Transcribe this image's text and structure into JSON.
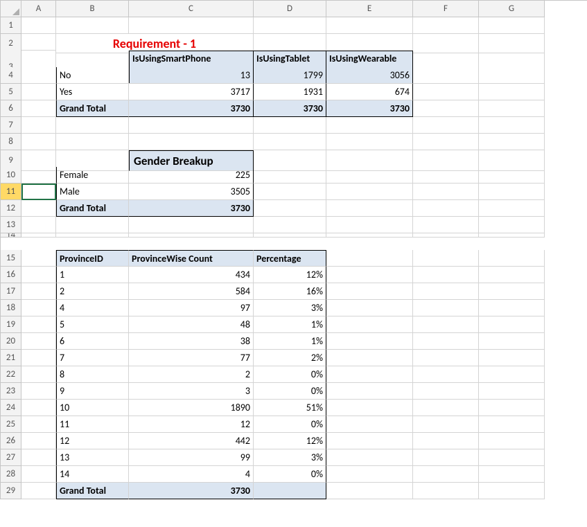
{
  "columns": [
    "",
    "A",
    "B",
    "C",
    "D",
    "E",
    "F",
    "G"
  ],
  "title": "Requirement - 1",
  "table1": {
    "headers": [
      "IsUsingSmartPhone",
      "IsUsingTablet",
      "IsUsingWearable"
    ],
    "rows": [
      {
        "label": "No",
        "c": "13",
        "d": "1799",
        "e": "3056"
      },
      {
        "label": "Yes",
        "c": "3717",
        "d": "1931",
        "e": "674"
      }
    ],
    "total_label": "Grand Total",
    "total": {
      "c": "3730",
      "d": "3730",
      "e": "3730"
    }
  },
  "gender": {
    "title": "Gender Breakup",
    "rows": [
      {
        "label": "Female",
        "val": "225"
      },
      {
        "label": "Male",
        "val": "3505"
      }
    ],
    "total_label": "Grand Total",
    "total": "3730"
  },
  "province": {
    "h1": "ProvinceID",
    "h2": "ProvinceWise Count",
    "h3": "Percentage",
    "rows": [
      {
        "id": "1",
        "count": "434",
        "pct": "12%"
      },
      {
        "id": "2",
        "count": "584",
        "pct": "16%"
      },
      {
        "id": "4",
        "count": "97",
        "pct": "3%"
      },
      {
        "id": "5",
        "count": "48",
        "pct": "1%"
      },
      {
        "id": "6",
        "count": "38",
        "pct": "1%"
      },
      {
        "id": "7",
        "count": "77",
        "pct": "2%"
      },
      {
        "id": "8",
        "count": "2",
        "pct": "0%"
      },
      {
        "id": "9",
        "count": "3",
        "pct": "0%"
      },
      {
        "id": "10",
        "count": "1890",
        "pct": "51%"
      },
      {
        "id": "11",
        "count": "12",
        "pct": "0%"
      },
      {
        "id": "12",
        "count": "442",
        "pct": "12%"
      },
      {
        "id": "13",
        "count": "99",
        "pct": "3%"
      },
      {
        "id": "14",
        "count": "4",
        "pct": "0%"
      }
    ],
    "total_label": "Grand Total",
    "total": "3730"
  }
}
